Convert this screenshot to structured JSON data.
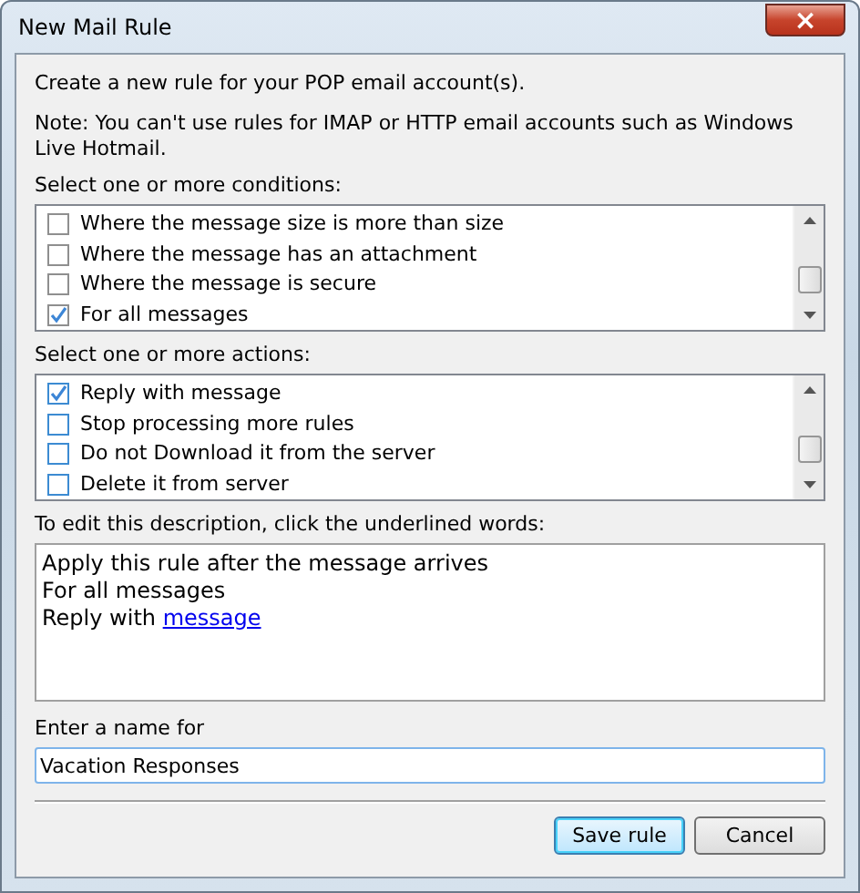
{
  "window": {
    "title": "New Mail Rule",
    "close": "×"
  },
  "intro": "Create a new rule for your POP email account(s).",
  "note": "Note: You can't use rules for IMAP or HTTP email accounts such as Windows Live Hotmail.",
  "conditions": {
    "label": "Select one or more conditions:",
    "focused": false,
    "items": [
      {
        "label": "Where the message size is more than size",
        "checked": false
      },
      {
        "label": "Where the message has an attachment",
        "checked": false
      },
      {
        "label": "Where the message is secure",
        "checked": false
      },
      {
        "label": "For all messages",
        "checked": true
      }
    ]
  },
  "actions": {
    "label": "Select one or more actions:",
    "focused": true,
    "items": [
      {
        "label": "Reply with message",
        "checked": true
      },
      {
        "label": "Stop processing more rules",
        "checked": false
      },
      {
        "label": "Do not Download it from the server",
        "checked": false
      },
      {
        "label": "Delete it from server",
        "checked": false
      }
    ]
  },
  "description": {
    "label": "To edit this description, click the underlined words:",
    "lines": [
      {
        "text": "Apply this rule after the message arrives"
      },
      {
        "text": "For all messages"
      },
      {
        "text": "Reply with ",
        "link": "message"
      }
    ]
  },
  "name_field": {
    "label": "Enter a name for",
    "value": "Vacation Responses"
  },
  "buttons": [
    {
      "label": "Save rule",
      "default": true
    },
    {
      "label": "Cancel",
      "default": false
    }
  ]
}
